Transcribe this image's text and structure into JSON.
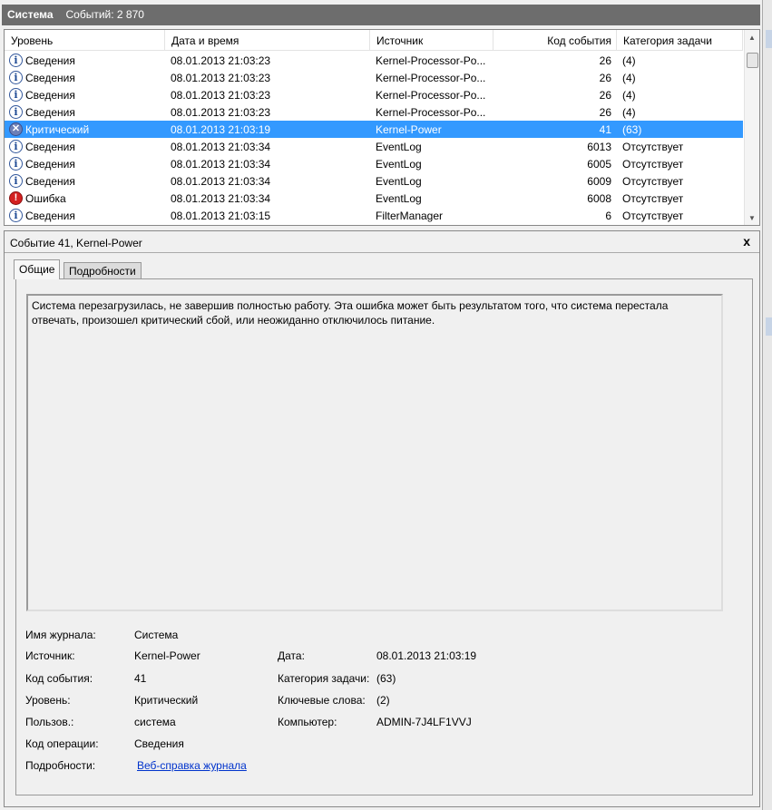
{
  "titlebar": {
    "log": "Система",
    "count": "Событий: 2 870"
  },
  "columns": [
    "Уровень",
    "Дата и время",
    "Источник",
    "Код события",
    "Категория задачи"
  ],
  "rows": [
    {
      "level": "Сведения",
      "icon": "info",
      "date": "08.01.2013 21:03:23",
      "source": "Kernel-Processor-Po...",
      "code": "26",
      "category": "(4)"
    },
    {
      "level": "Сведения",
      "icon": "info",
      "date": "08.01.2013 21:03:23",
      "source": "Kernel-Processor-Po...",
      "code": "26",
      "category": "(4)"
    },
    {
      "level": "Сведения",
      "icon": "info",
      "date": "08.01.2013 21:03:23",
      "source": "Kernel-Processor-Po...",
      "code": "26",
      "category": "(4)"
    },
    {
      "level": "Сведения",
      "icon": "info",
      "date": "08.01.2013 21:03:23",
      "source": "Kernel-Processor-Po...",
      "code": "26",
      "category": "(4)"
    },
    {
      "level": "Критический",
      "icon": "crit",
      "date": "08.01.2013 21:03:19",
      "source": "Kernel-Power",
      "code": "41",
      "category": "(63)",
      "selected": true
    },
    {
      "level": "Сведения",
      "icon": "info",
      "date": "08.01.2013 21:03:34",
      "source": "EventLog",
      "code": "6013",
      "category": "Отсутствует"
    },
    {
      "level": "Сведения",
      "icon": "info",
      "date": "08.01.2013 21:03:34",
      "source": "EventLog",
      "code": "6005",
      "category": "Отсутствует"
    },
    {
      "level": "Сведения",
      "icon": "info",
      "date": "08.01.2013 21:03:34",
      "source": "EventLog",
      "code": "6009",
      "category": "Отсутствует"
    },
    {
      "level": "Ошибка",
      "icon": "err",
      "date": "08.01.2013 21:03:34",
      "source": "EventLog",
      "code": "6008",
      "category": "Отсутствует"
    },
    {
      "level": "Сведения",
      "icon": "info",
      "date": "08.01.2013 21:03:15",
      "source": "FilterManager",
      "code": "6",
      "category": "Отсутствует"
    }
  ],
  "detail": {
    "title": "Событие 41, Kernel-Power",
    "close": "x",
    "tabs": [
      "Общие",
      "Подробности"
    ],
    "message": "Система перезагрузилась, не завершив полностью работу. Эта ошибка может быть результатом того, что система перестала отвечать, произошел критический сбой, или неожиданно отключилось питание.",
    "fields": {
      "log_label": "Имя журнала:",
      "log": "Система",
      "source_label": "Источник:",
      "source": "Kernel-Power",
      "date_label": "Дата:",
      "date": "08.01.2013 21:03:19",
      "code_label": "Код события:",
      "code": "41",
      "category_label": "Категория задачи:",
      "category": "(63)",
      "level_label": "Уровень:",
      "level": "Критический",
      "keywords_label": "Ключевые слова:",
      "keywords": "(2)",
      "user_label": "Пользов.:",
      "user": "система",
      "computer_label": "Компьютер:",
      "computer": "ADMIN-7J4LF1VVJ",
      "opcode_label": "Код операции:",
      "opcode": "Сведения",
      "more_label": "Подробности:",
      "more_link": "Веб-справка журнала"
    }
  }
}
